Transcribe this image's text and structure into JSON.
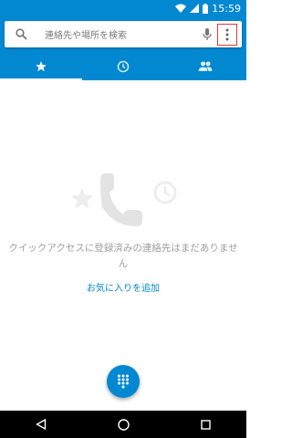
{
  "status_bar": {
    "time": "15:59",
    "icons": [
      "wifi-icon",
      "signal-icon",
      "battery-icon"
    ]
  },
  "search": {
    "placeholder": "連絡先や場所を検索",
    "icons": [
      "search-icon",
      "mic-icon",
      "more-vert-icon"
    ]
  },
  "tabs": [
    {
      "icon": "star-icon",
      "active": true
    },
    {
      "icon": "clock-icon",
      "active": false
    },
    {
      "icon": "contacts-icon",
      "active": false
    }
  ],
  "empty_state": {
    "message": "クイックアクセスに登録済みの連絡先はまだありません",
    "action_label": "お気に入りを追加",
    "art_icons": [
      "star-icon",
      "phone-icon",
      "clock-icon"
    ]
  },
  "fab": {
    "icon": "dialpad-icon"
  },
  "nav": [
    "back-icon",
    "home-icon",
    "recents-icon"
  ],
  "colors": {
    "primary": "#0288d1",
    "highlight_box": "#e53935",
    "muted_text": "#9e9e9e"
  }
}
